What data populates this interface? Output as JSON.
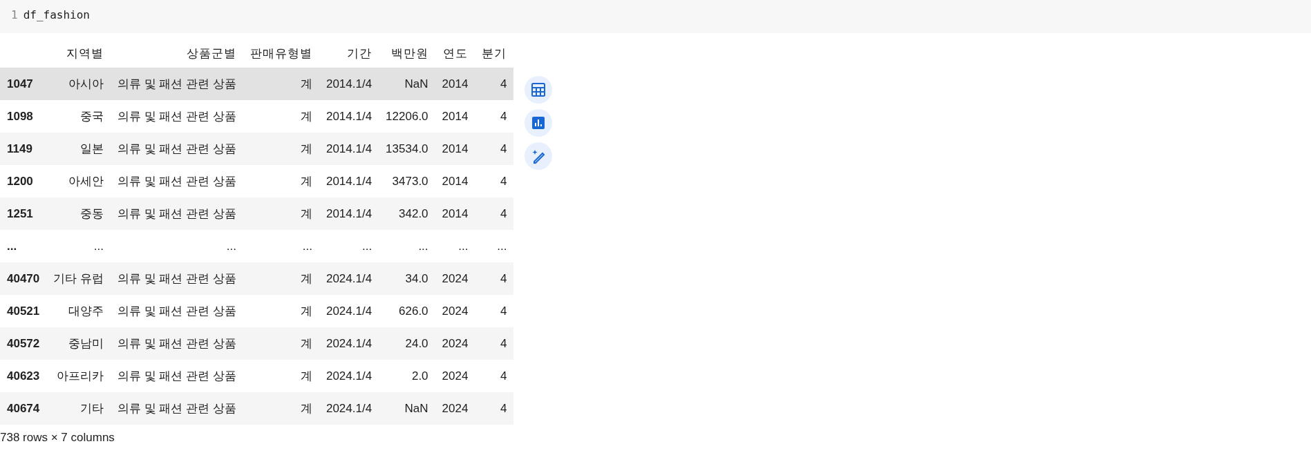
{
  "code_cell": {
    "line_number": "1",
    "code": "df_fashion"
  },
  "table": {
    "columns": [
      "지역별",
      "상품군별",
      "판매유형별",
      "기간",
      "백만원",
      "연도",
      "분기"
    ],
    "rows": [
      {
        "index": "1047",
        "cells": [
          "아시아",
          "의류 및 패션 관련 상품",
          "계",
          "2014.1/4",
          "NaN",
          "2014",
          "4"
        ],
        "highlighted": true
      },
      {
        "index": "1098",
        "cells": [
          "중국",
          "의류 및 패션 관련 상품",
          "계",
          "2014.1/4",
          "12206.0",
          "2014",
          "4"
        ],
        "highlighted": false
      },
      {
        "index": "1149",
        "cells": [
          "일본",
          "의류 및 패션 관련 상품",
          "계",
          "2014.1/4",
          "13534.0",
          "2014",
          "4"
        ],
        "highlighted": false
      },
      {
        "index": "1200",
        "cells": [
          "아세안",
          "의류 및 패션 관련 상품",
          "계",
          "2014.1/4",
          "3473.0",
          "2014",
          "4"
        ],
        "highlighted": false
      },
      {
        "index": "1251",
        "cells": [
          "중동",
          "의류 및 패션 관련 상품",
          "계",
          "2014.1/4",
          "342.0",
          "2014",
          "4"
        ],
        "highlighted": false
      },
      {
        "index": "...",
        "cells": [
          "...",
          "...",
          "...",
          "...",
          "...",
          "...",
          "..."
        ],
        "highlighted": false
      },
      {
        "index": "40470",
        "cells": [
          "기타 유럽",
          "의류 및 패션 관련 상품",
          "계",
          "2024.1/4",
          "34.0",
          "2024",
          "4"
        ],
        "highlighted": false
      },
      {
        "index": "40521",
        "cells": [
          "대양주",
          "의류 및 패션 관련 상품",
          "계",
          "2024.1/4",
          "626.0",
          "2024",
          "4"
        ],
        "highlighted": false
      },
      {
        "index": "40572",
        "cells": [
          "중남미",
          "의류 및 패션 관련 상품",
          "계",
          "2024.1/4",
          "24.0",
          "2024",
          "4"
        ],
        "highlighted": false
      },
      {
        "index": "40623",
        "cells": [
          "아프리카",
          "의류 및 패션 관련 상품",
          "계",
          "2024.1/4",
          "2.0",
          "2024",
          "4"
        ],
        "highlighted": false
      },
      {
        "index": "40674",
        "cells": [
          "기타",
          "의류 및 패션 관련 상품",
          "계",
          "2024.1/4",
          "NaN",
          "2024",
          "4"
        ],
        "highlighted": false
      }
    ],
    "footer": "738 rows × 7 columns"
  }
}
